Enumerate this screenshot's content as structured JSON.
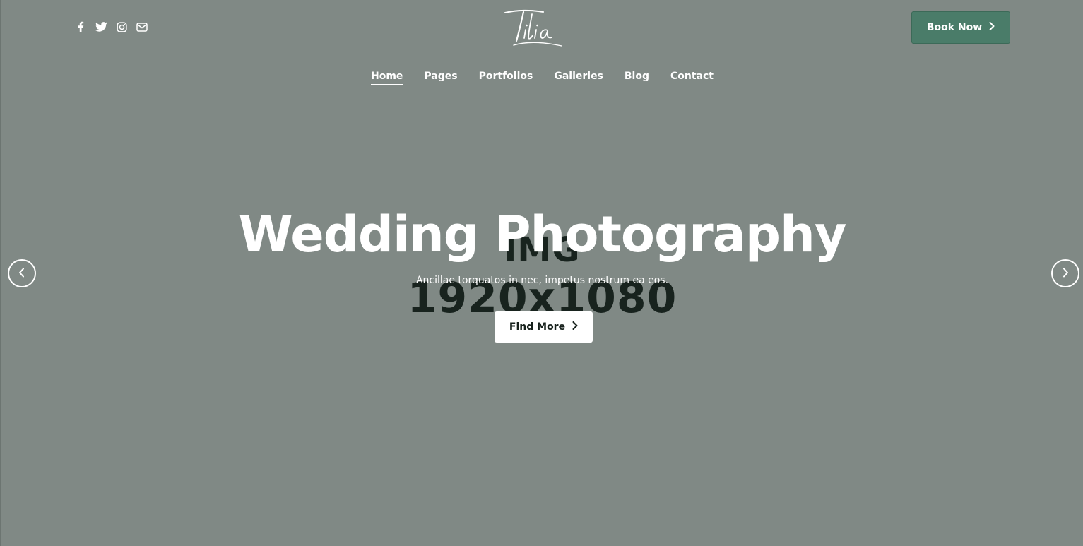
{
  "placeholder": {
    "line1": "IMG",
    "line2": "1920x1080"
  },
  "header": {
    "logo_text": "Tilia",
    "social_icons": [
      "facebook-icon",
      "twitter-icon",
      "instagram-icon",
      "mail-icon"
    ],
    "book_button": {
      "label": "Book Now",
      "icon": "chevron-right-icon",
      "color": "#4a7c69"
    },
    "nav": [
      {
        "label": "Home",
        "active": true
      },
      {
        "label": "Pages",
        "active": false
      },
      {
        "label": "Portfolios",
        "active": false
      },
      {
        "label": "Galleries",
        "active": false
      },
      {
        "label": "Blog",
        "active": false
      },
      {
        "label": "Contact",
        "active": false
      }
    ]
  },
  "hero": {
    "title": "Wedding Photography",
    "subtitle": "Ancillae torquatos in nec, impetus nostrum ea eos.",
    "button": {
      "label": "Find More",
      "icon": "chevron-right-icon"
    },
    "background_color": "#808985",
    "prev_icon": "chevron-left-icon",
    "next_icon": "chevron-right-icon"
  }
}
